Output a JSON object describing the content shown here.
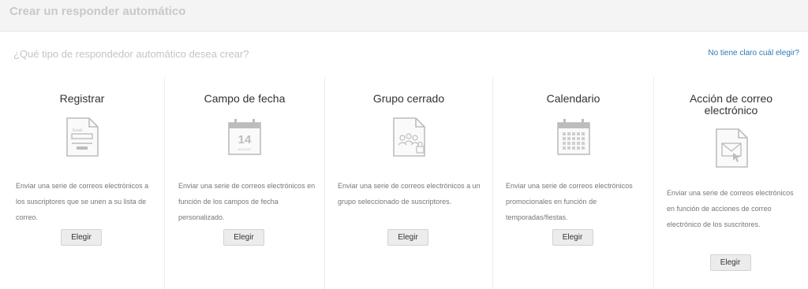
{
  "header": {
    "title": "Crear un responder automático"
  },
  "question": {
    "text": "¿Qué tipo de respondedor automático desea crear?",
    "help_link": "No tiene claro cuál elegir?"
  },
  "cards": [
    {
      "title": "Registrar",
      "icon": "signup-form-icon",
      "description": "Enviar una serie de correos electrónicos a los suscriptores que se unen a su lista de correo.",
      "button": "Elegir",
      "icon_text": "Email"
    },
    {
      "title": "Campo de fecha",
      "icon": "date-calendar-icon",
      "description": "Enviar una serie de correos electrónicos en función de los campos de fecha personalizado.",
      "button": "Elegir",
      "icon_day": "14",
      "icon_month": "AUGUST"
    },
    {
      "title": "Grupo cerrado",
      "icon": "closed-group-icon",
      "description": "Enviar una serie de correos electrónicos a un grupo seleccionado de suscriptores.",
      "button": "Elegir"
    },
    {
      "title": "Calendario",
      "icon": "calendar-grid-icon",
      "description": "Enviar una serie de correos electrónicos promocionales en función de temporadas/fiestas.",
      "button": "Elegir"
    },
    {
      "title": "Acción de correo electrónico",
      "icon": "email-action-icon",
      "description": "Enviar una serie de correos electrónicos en función de acciones de correo electrónico de los suscritores.",
      "button": "Elegir"
    }
  ],
  "colors": {
    "link": "#2a7ab8",
    "icon": "#bdbdbd",
    "header_bg": "#f4f4f4"
  }
}
